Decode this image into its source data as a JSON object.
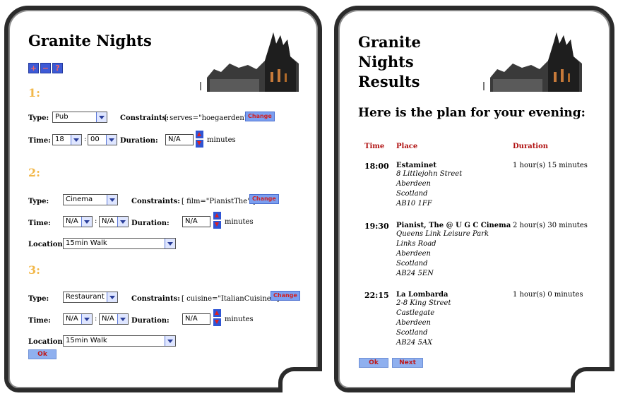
{
  "left": {
    "title": "Granite Nights",
    "toolbar": {
      "add": "+",
      "remove": "−",
      "help": "?"
    },
    "minutes_label": "minutes",
    "ok_label": "Ok",
    "labels": {
      "type": "Type:",
      "constraints": "Constraints:",
      "time": "Time:",
      "duration": "Duration:",
      "location": "Location:"
    },
    "change_label": "Change",
    "slots": [
      {
        "number": "1:",
        "type": "Pub",
        "constraints": "[ serves=\"hoegaerden\" ]",
        "hour": "18",
        "minute": "00",
        "duration": "N/A"
      },
      {
        "number": "2:",
        "type": "Cinema",
        "constraints": "[ film=\"PianistThe\" ]",
        "hour": "N/A",
        "minute": "N/A",
        "duration": "N/A",
        "location": "15min Walk"
      },
      {
        "number": "3:",
        "type": "Restaurant",
        "constraints": "[ cuisine=\"ItalianCuisine\" ]",
        "hour": "N/A",
        "minute": "N/A",
        "duration": "N/A",
        "location": "15min Walk"
      }
    ]
  },
  "right": {
    "title_lines": [
      "Granite",
      "Nights",
      "Results"
    ],
    "heading": "Here is the plan for your evening:",
    "columns": {
      "time": "Time",
      "place": "Place",
      "duration": "Duration"
    },
    "rows": [
      {
        "time": "18:00",
        "place": "Estaminet",
        "address": [
          "8 Littlejohn Street",
          "Aberdeen",
          "Scotland",
          "AB10 1FF"
        ],
        "duration": "1 hour(s) 15 minutes"
      },
      {
        "time": "19:30",
        "place": "Pianist, The @ U G C Cinema",
        "address": [
          "Queens Link Leisure Park",
          "Links Road",
          "Aberdeen",
          "Scotland",
          "AB24 5EN"
        ],
        "duration": "2 hour(s) 30 minutes"
      },
      {
        "time": "22:15",
        "place": "La Lombarda",
        "address": [
          "2-8 King Street",
          "Castlegate",
          "Aberdeen",
          "Scotland",
          "AB24 5AX"
        ],
        "duration": "1 hour(s) 0 minutes"
      }
    ],
    "ok_label": "Ok",
    "next_label": "Next"
  }
}
